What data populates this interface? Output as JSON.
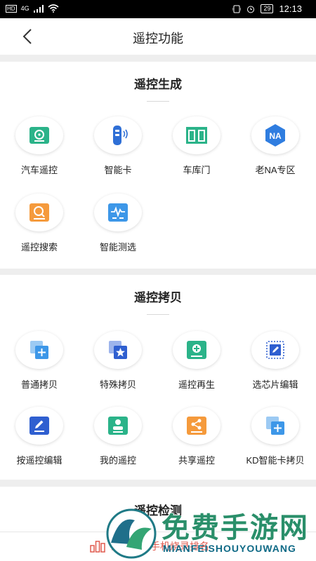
{
  "status_bar": {
    "network": "4G",
    "hd": "HD",
    "battery": "29",
    "time": "12:13"
  },
  "app_bar": {
    "title": "遥控功能"
  },
  "sections": [
    {
      "title": "遥控生成",
      "items": [
        {
          "label": "汽车遥控",
          "icon": "steering-wheel-icon",
          "color": "#2bb389"
        },
        {
          "label": "智能卡",
          "icon": "smart-key-fob-icon",
          "color": "#2f6fd6"
        },
        {
          "label": "车库门",
          "icon": "garage-door-icon",
          "color": "#2bb389"
        },
        {
          "label": "老NA专区",
          "icon": "na-hexagon-icon",
          "color": "#2f7de0"
        },
        {
          "label": "遥控搜索",
          "icon": "search-icon",
          "color": "#f59a3c"
        },
        {
          "label": "智能测选",
          "icon": "waveform-icon",
          "color": "#3d97e8"
        }
      ]
    },
    {
      "title": "遥控拷贝",
      "items": [
        {
          "label": "普通拷贝",
          "icon": "copy-plus-icon",
          "color": "#3d97e8"
        },
        {
          "label": "特殊拷贝",
          "icon": "copy-star-icon",
          "color": "#2f5fd0"
        },
        {
          "label": "遥控再生",
          "icon": "regenerate-plus-icon",
          "color": "#2bb389"
        },
        {
          "label": "选芯片编辑",
          "icon": "chip-edit-icon",
          "color": "#2f5fd0"
        },
        {
          "label": "按遥控编辑",
          "icon": "edit-pencil-icon",
          "color": "#2f5fd0"
        },
        {
          "label": "我的遥控",
          "icon": "my-remote-icon",
          "color": "#2bb389"
        },
        {
          "label": "共享遥控",
          "icon": "share-icon",
          "color": "#f59a3c"
        },
        {
          "label": "KD智能卡拷贝",
          "icon": "copy-plus-icon",
          "color": "#3d97e8"
        }
      ]
    },
    {
      "title": "遥控检测"
    }
  ],
  "bottom_bar": {
    "rank_text": "查看我的手机烧录排名",
    "icon": "bar-chart-icon",
    "color": "#e05a4e"
  },
  "watermark": {
    "title": "免费手游网",
    "subtitle": "MIANFEISHOUYOUWANG"
  }
}
